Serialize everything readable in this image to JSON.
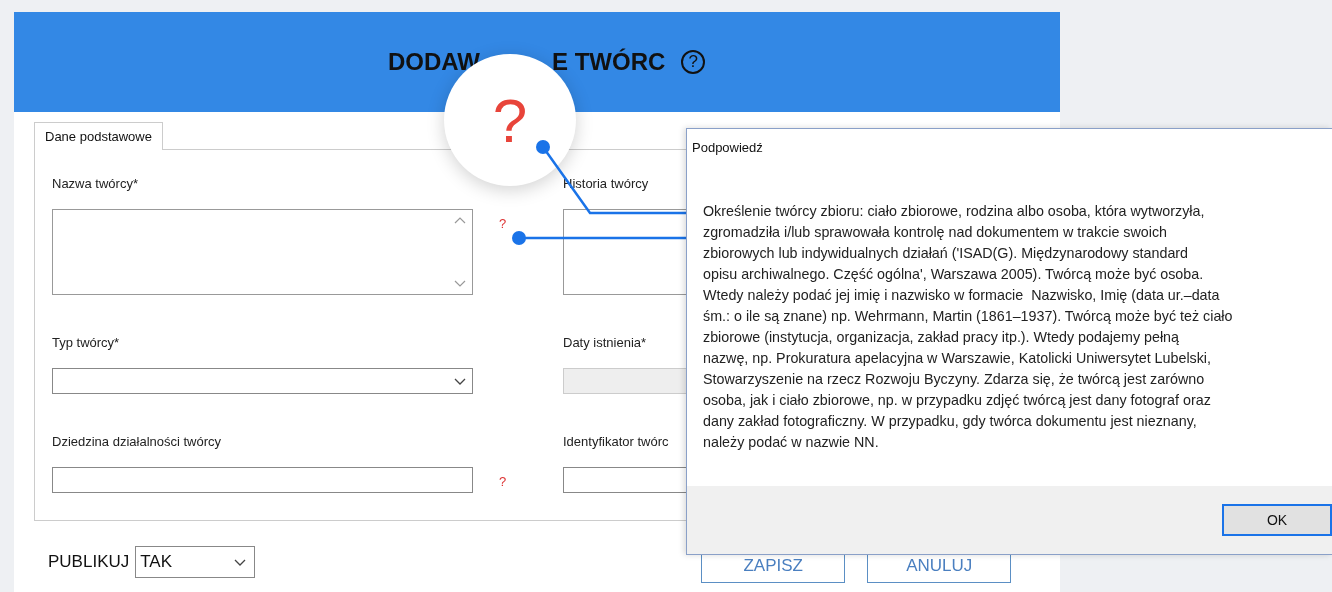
{
  "app": {
    "title_parts": [
      "DODAW",
      "E TWÓRC"
    ],
    "title_icon": "?",
    "tabs": [
      {
        "label": "Dane podstawowe",
        "selected": true
      }
    ],
    "fields": [
      {
        "label": "Nazwa twórcy*",
        "kind": "textarea",
        "help": "?",
        "disabled": false
      },
      {
        "label": "Historia twórcy",
        "kind": "textarea",
        "disabled": false
      },
      {
        "label": "Typ twórcy*",
        "kind": "select",
        "disabled": false
      },
      {
        "label": "Daty istnienia*",
        "kind": "input",
        "disabled": true
      },
      {
        "label": "Dziedzina działalności twórcy",
        "kind": "input",
        "help": "?",
        "disabled": false
      },
      {
        "label": "Identyfikator twórc",
        "kind": "input",
        "disabled": false
      }
    ],
    "publish": {
      "label": "PUBLIKUJ",
      "value": "TAK"
    },
    "buttons": [
      "ZAPISZ",
      "ANULUJ"
    ]
  },
  "callout": {
    "symbol": "?"
  },
  "dialog": {
    "title": "Podpowiedź",
    "lines": [
      "Określenie twórcy zbioru: ciało zbiorowe, rodzina albo osoba, która wytworzyła,",
      "zgromadziła i/lub sprawowała kontrolę nad dokumentem w trakcie swoich",
      "zbiorowych lub indywidualnych działań ('ISAD(G). Międzynarodowy standard",
      "opisu archiwalnego. Część ogólna', Warszawa 2005). Twórcą może być osoba.",
      "Wtedy należy podać jej imię i nazwisko w formacie  Nazwisko, Imię (data ur.–data",
      "śm.: o ile są znane) np. Wehrmann, Martin (1861–1937). Twórcą może być też ciało",
      "zbiorowe (instytucja, organizacja, zakład pracy itp.). Wtedy podajemy pełną",
      "nazwę, np. Prokuratura apelacyjna w Warszawie, Katolicki Uniwersytet Lubelski,",
      "Stowarzyszenie na rzecz Rozwoju Byczyny. Zdarza się, że twórcą jest zarówno",
      "osoba, jak i ciało zbiorowe, np. w przypadku zdjęć twórcą jest dany fotograf oraz",
      "dany zakład fotograficzny. W przypadku, gdy twórca dokumentu jest nieznany,",
      "należy podać w nazwie NN."
    ],
    "ok": "OK"
  }
}
